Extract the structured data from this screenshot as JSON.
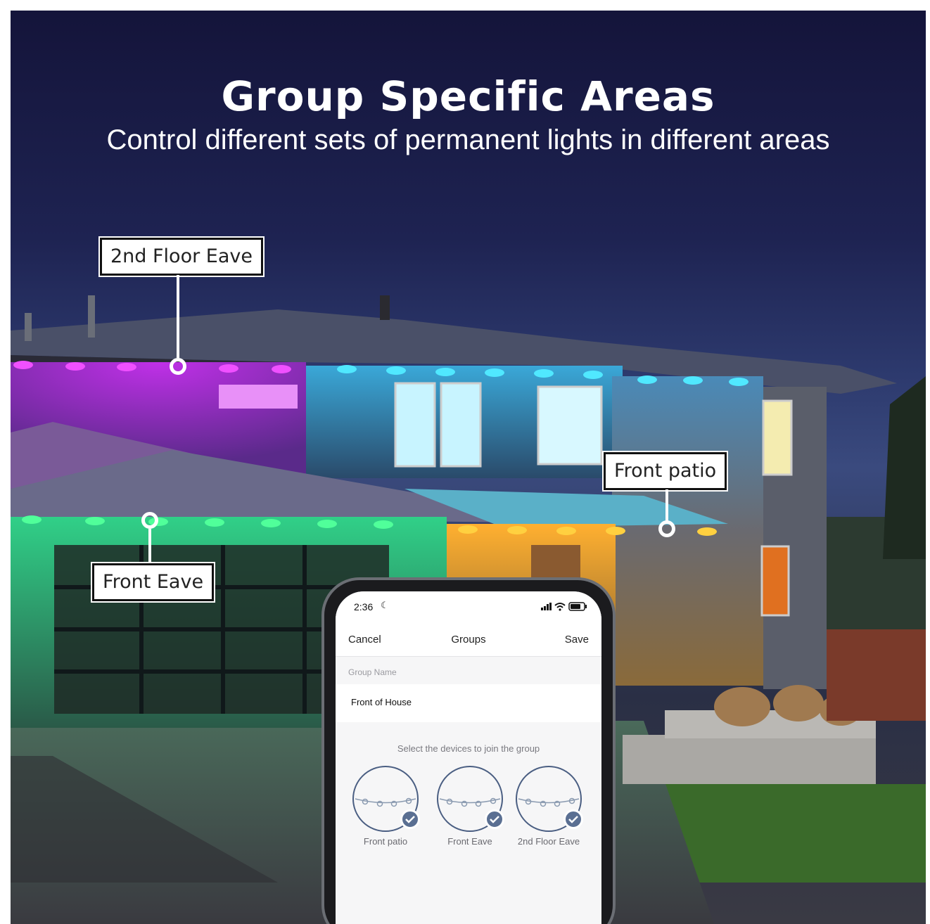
{
  "header": {
    "title": "Group Specific Areas",
    "subtitle": "Control different sets of permanent lights in different areas"
  },
  "callouts": {
    "second_floor": "2nd Floor Eave",
    "front_patio": "Front patio",
    "front_eave": "Front Eave"
  },
  "phone": {
    "status": {
      "time": "2:36"
    },
    "nav": {
      "cancel": "Cancel",
      "title": "Groups",
      "save": "Save"
    },
    "group_name_label": "Group Name",
    "group_name_value": "Front of House",
    "select_prompt": "Select the devices to join the group",
    "devices": [
      {
        "label": "Front patio",
        "selected": true
      },
      {
        "label": "Front Eave",
        "selected": true
      },
      {
        "label": "2nd Floor Eave",
        "selected": true
      }
    ]
  },
  "colors": {
    "sky": "#1e2352",
    "purple_light": "#c020e0",
    "cyan_light": "#20c8ff",
    "green_light": "#20e080",
    "amber_light": "#ffb020",
    "check": "#5a6f92"
  }
}
